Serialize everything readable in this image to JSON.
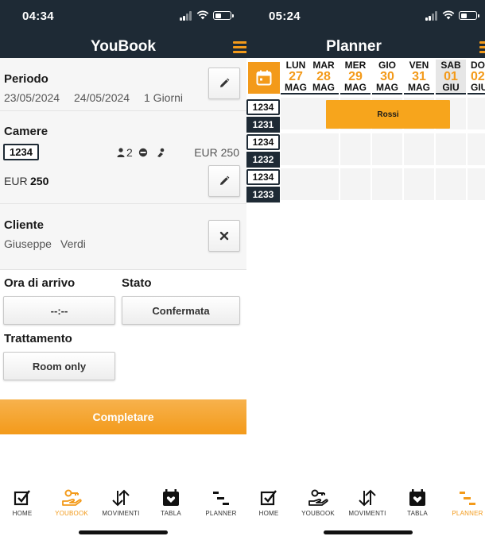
{
  "left": {
    "status_time": "04:34",
    "title": "YouBook",
    "periodo": {
      "label": "Periodo",
      "start": "23/05/2024",
      "end": "24/05/2024",
      "nights": "1 Giorni"
    },
    "camere": {
      "label": "Camere",
      "room": "1234",
      "guests": "2",
      "price": "EUR 250",
      "total_currency": "EUR",
      "total_value": "250"
    },
    "cliente": {
      "label": "Cliente",
      "first_name": "Giuseppe",
      "last_name": "Verdi"
    },
    "arrivo": {
      "label": "Ora di arrivo",
      "value": "--:--"
    },
    "stato": {
      "label": "Stato",
      "value": "Confermata"
    },
    "trattamento": {
      "label": "Trattamento",
      "value": "Room only"
    },
    "complete_label": "Completare"
  },
  "right": {
    "status_time": "05:24",
    "title": "Planner",
    "days": [
      {
        "name": "LUN",
        "num": "27",
        "month": "MAG",
        "weekend": false
      },
      {
        "name": "MAR",
        "num": "28",
        "month": "MAG",
        "weekend": false
      },
      {
        "name": "MER",
        "num": "29",
        "month": "MAG",
        "weekend": false
      },
      {
        "name": "GIO",
        "num": "30",
        "month": "MAG",
        "weekend": false
      },
      {
        "name": "VEN",
        "num": "31",
        "month": "MAG",
        "weekend": false
      },
      {
        "name": "SAB",
        "num": "01",
        "month": "GIU",
        "weekend": true
      },
      {
        "name": "DOM",
        "num": "02",
        "month": "GIU",
        "weekend": false
      }
    ],
    "rooms": [
      {
        "top": "1234",
        "bottom": "1231"
      },
      {
        "top": "1234",
        "bottom": "1232"
      },
      {
        "top": "1234",
        "bottom": "1233"
      }
    ],
    "booking": {
      "guest": "Rossi"
    }
  },
  "tabs": [
    {
      "label": "HOME",
      "icon": "home-checkbox-icon"
    },
    {
      "label": "YOUBOOK",
      "icon": "youbook-hand-key-icon"
    },
    {
      "label": "MOVIMENTI",
      "icon": "movements-arrows-icon"
    },
    {
      "label": "TABLA",
      "icon": "tabla-calendar-heart-icon"
    },
    {
      "label": "PLANNER",
      "icon": "planner-bars-icon"
    }
  ],
  "colors": {
    "header_bg": "#1e2a35",
    "accent": "#f39a1a",
    "booking": "#f7a51c"
  }
}
